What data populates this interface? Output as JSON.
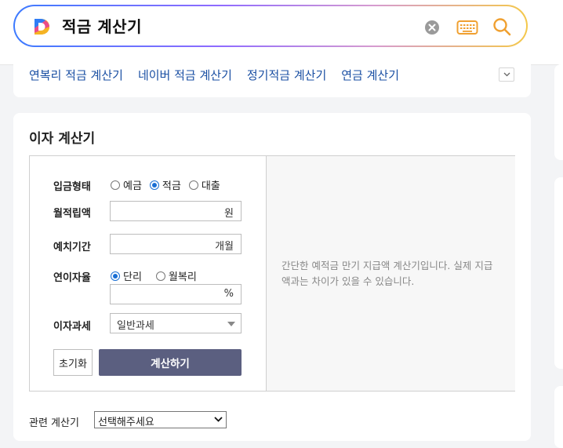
{
  "search": {
    "query": "적금 계산기"
  },
  "related_links": [
    "연복리 적금 계산기",
    "네이버 적금 계산기",
    "정기적금 계산기",
    "연금 계산기"
  ],
  "calculator": {
    "title": "이자 계산기",
    "deposit_type": {
      "label": "입금형태",
      "options": [
        "예금",
        "적금",
        "대출"
      ],
      "selected": "적금"
    },
    "monthly_amount": {
      "label": "월적립액",
      "unit": "원",
      "value": ""
    },
    "period": {
      "label": "예치기간",
      "unit": "개월",
      "value": ""
    },
    "interest_rate": {
      "label": "연이자율",
      "options": [
        "단리",
        "월복리"
      ],
      "selected": "단리",
      "unit": "%"
    },
    "tax": {
      "label": "이자과세",
      "selected": "일반과세"
    },
    "reset_label": "초기화",
    "calc_label": "계산하기",
    "description": "간단한 예적금 만기 지급액 계산기입니다. 실제 지급액과는 차이가 있을 수 있습니다."
  },
  "related_calc": {
    "label": "관련 계산기",
    "selected": "선택해주세요"
  },
  "colors": {
    "link": "#1a4fa3",
    "button": "#5b5f80",
    "radio_checked": "#1a6fd4"
  }
}
